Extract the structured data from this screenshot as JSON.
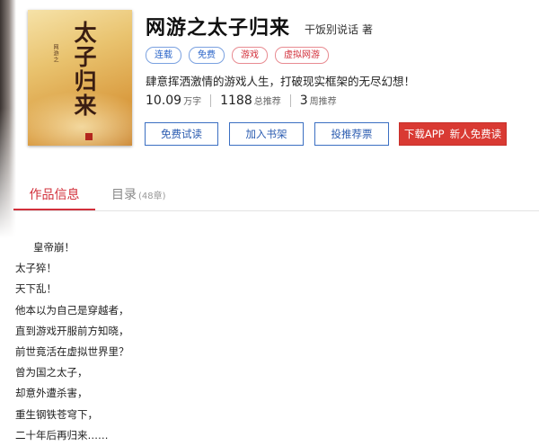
{
  "book": {
    "title": "网游之太子归来",
    "author": "干饭别说话",
    "author_suffix": "著",
    "cover": {
      "title": "太子归来",
      "subtitle": "网游之"
    },
    "tags": [
      {
        "label": "连载",
        "color": "#2a64c8"
      },
      {
        "label": "免费",
        "color": "#2a64c8"
      },
      {
        "label": "游戏",
        "color": "#d2303b"
      },
      {
        "label": "虚拟网游",
        "color": "#d2303b"
      }
    ],
    "intro": "肆意挥洒激情的游戏人生，打破现实框架的无尽幻想！",
    "stats": {
      "word_count": "10.09",
      "word_unit": "万字",
      "total_recs": "1188",
      "total_recs_label": "总推荐",
      "weekly_recs": "3",
      "weekly_recs_label": "周推荐"
    }
  },
  "buttons": {
    "free_read": "免费试读",
    "add_shelf": "加入书架",
    "vote": "投推荐票",
    "download_app": "下载APP",
    "download_app_sub": "新人免费读"
  },
  "tabs": {
    "info": "作品信息",
    "toc": "目录",
    "toc_count": "(48章)"
  },
  "synopsis": [
    "皇帝崩！",
    "太子猝！",
    "天下乱！",
    "他本以为自己是穿越者，",
    "直到游戏开服前方知晓，",
    "前世竟活在虚拟世界里？",
    "曾为国之太子，",
    "却意外遭杀害，",
    "重生钢铁苍穹下，",
    "二十年后再归来……"
  ],
  "colors": {
    "accent_red": "#d2303b",
    "accent_blue": "#2a64c8"
  }
}
